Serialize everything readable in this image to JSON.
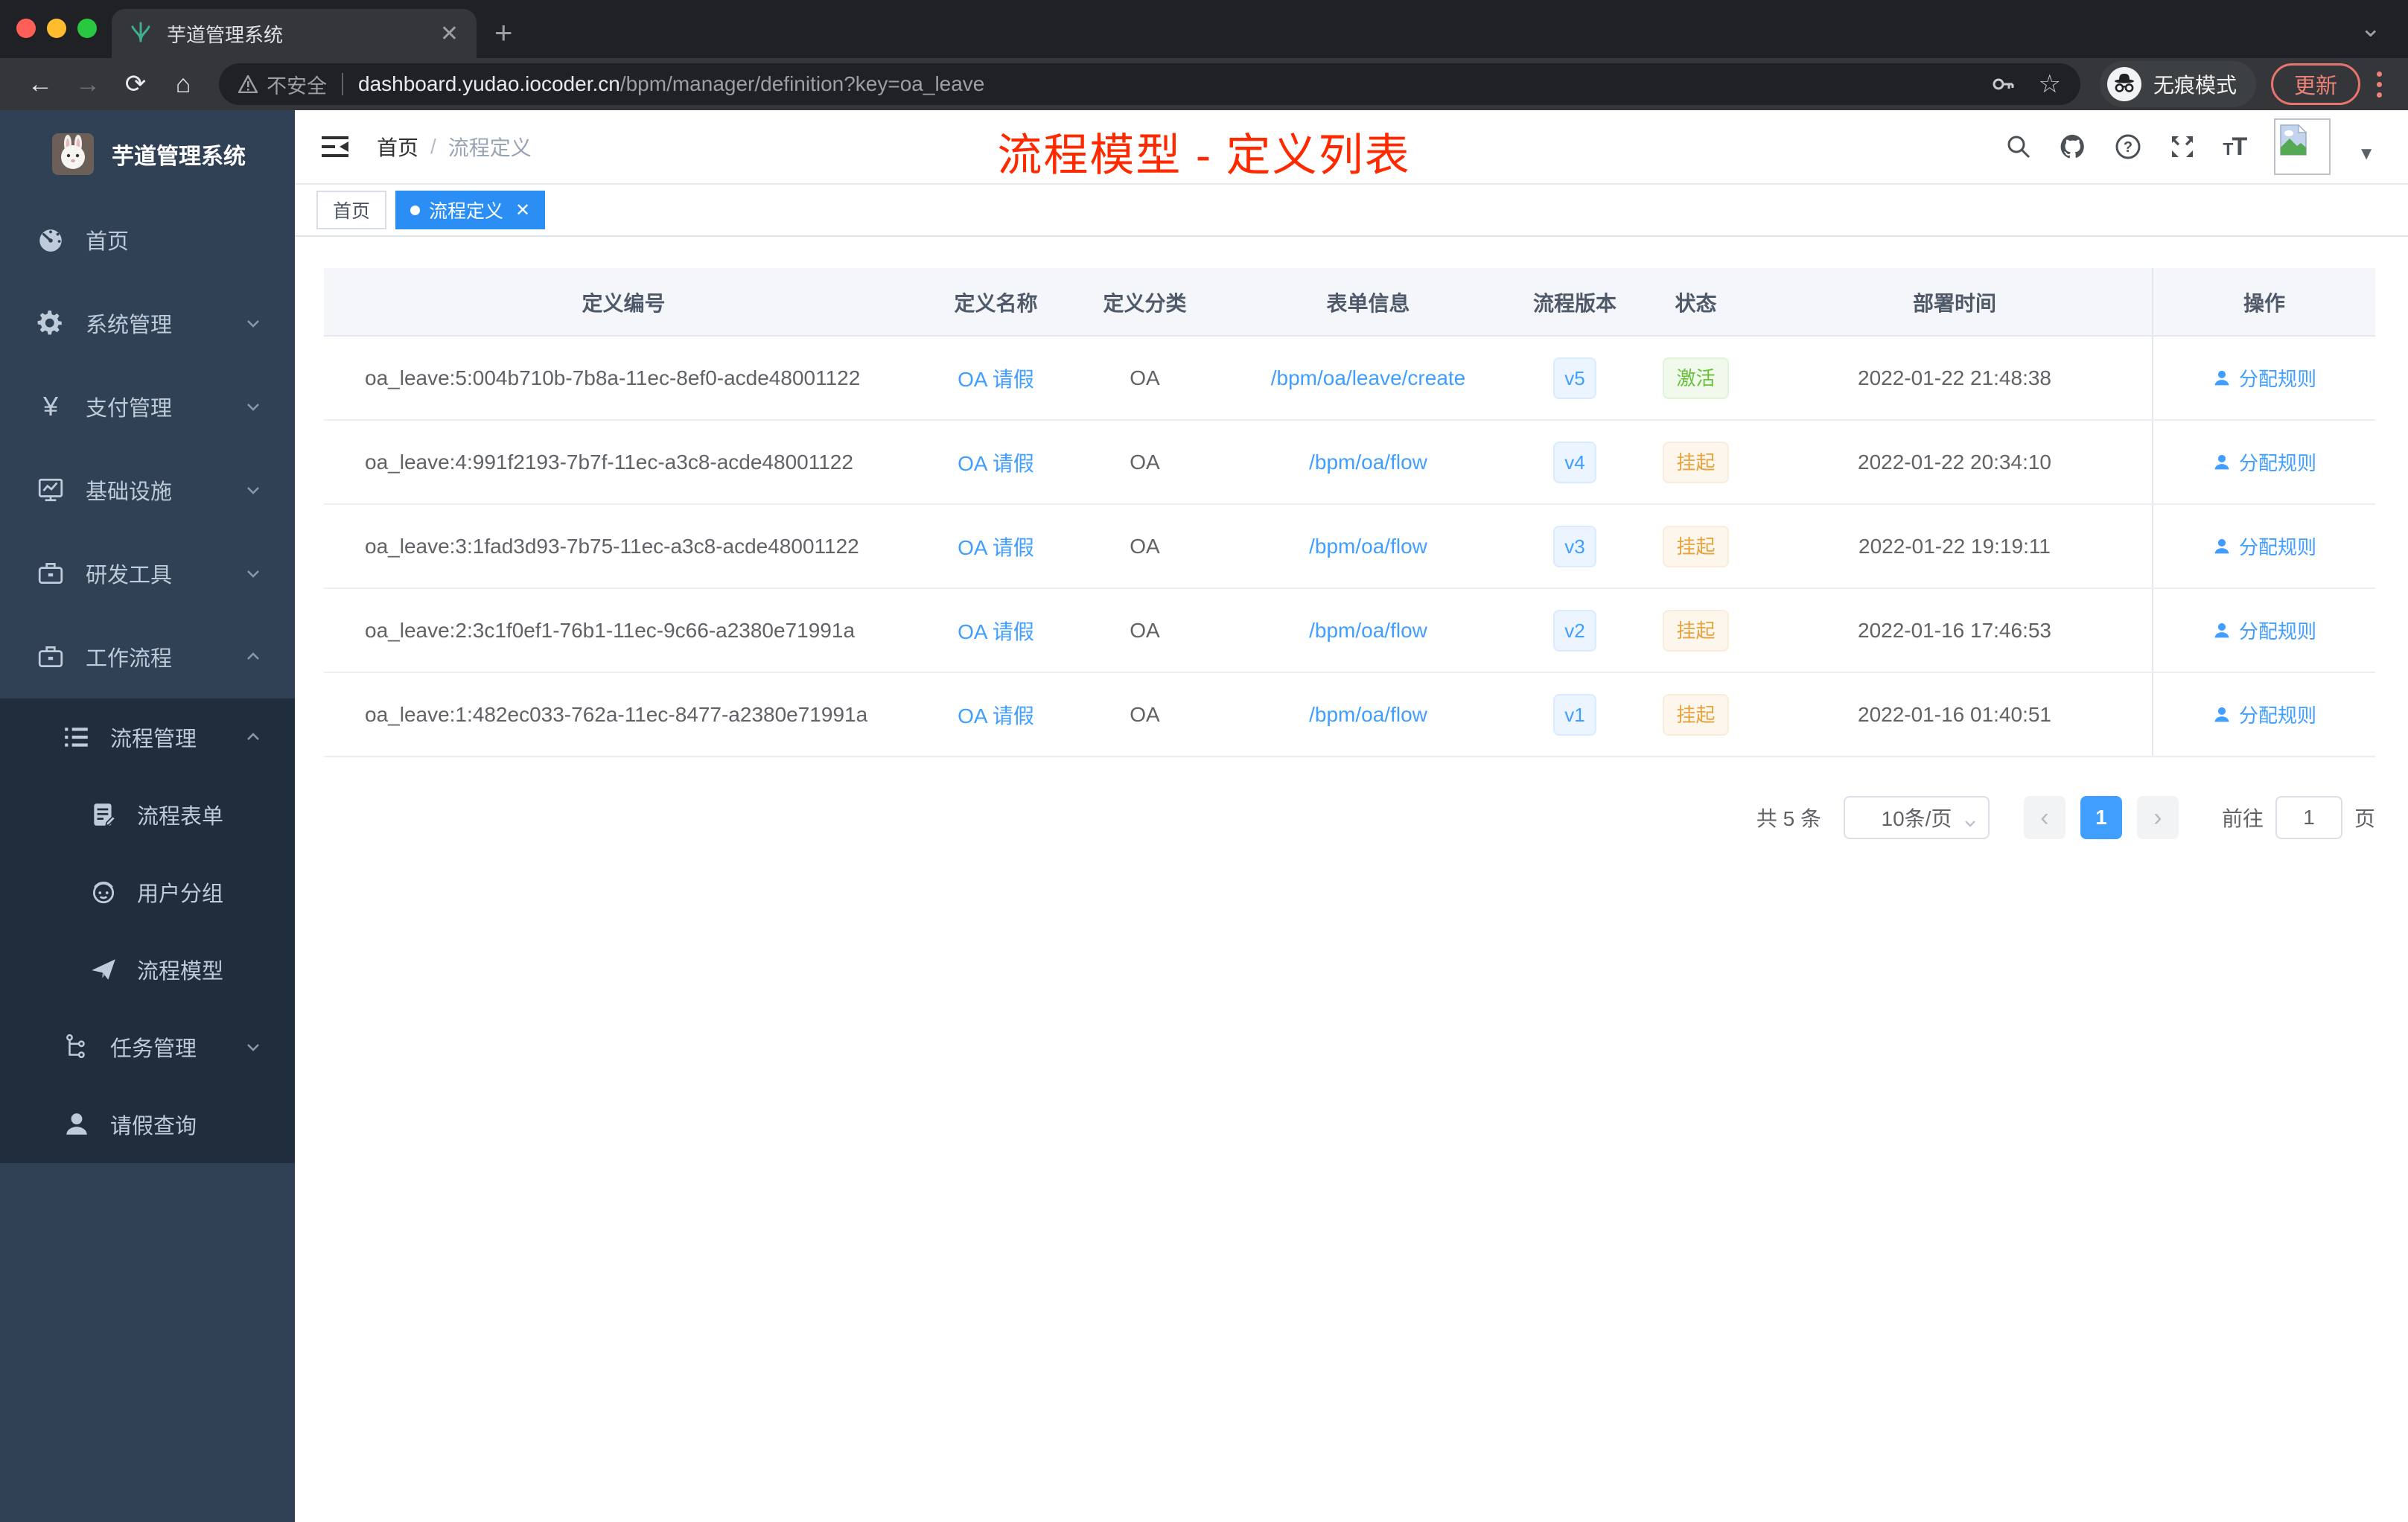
{
  "browser": {
    "tab_title": "芋道管理系统",
    "new_tab": "+",
    "security_label": "不安全",
    "url_domain": "dashboard.yudao.iocoder.cn",
    "url_path": "/bpm/manager/definition?key=oa_leave",
    "incognito_label": "无痕模式",
    "update_label": "更新"
  },
  "sidebar": {
    "logo_title": "芋道管理系统",
    "items": [
      {
        "label": "首页",
        "icon": "gauge-icon"
      },
      {
        "label": "系统管理",
        "icon": "gear-icon"
      },
      {
        "label": "支付管理",
        "icon": "yen-icon"
      },
      {
        "label": "基础设施",
        "icon": "monitor-icon"
      },
      {
        "label": "研发工具",
        "icon": "briefcase-icon"
      },
      {
        "label": "工作流程",
        "icon": "briefcase-icon"
      },
      {
        "label": "流程管理",
        "icon": "list-icon"
      },
      {
        "label": "流程表单",
        "icon": "form-icon"
      },
      {
        "label": "用户分组",
        "icon": "group-icon"
      },
      {
        "label": "流程模型",
        "icon": "paper-plane-icon"
      },
      {
        "label": "任务管理",
        "icon": "tree-icon"
      },
      {
        "label": "请假查询",
        "icon": "person-icon"
      }
    ]
  },
  "navbar": {
    "breadcrumb_home": "首页",
    "breadcrumb_separator": "/",
    "breadcrumb_current": "流程定义",
    "overlay_title": "流程模型 - 定义列表"
  },
  "tags": {
    "home": "首页",
    "active": "流程定义"
  },
  "table": {
    "columns": [
      "定义编号",
      "定义名称",
      "定义分类",
      "表单信息",
      "流程版本",
      "状态",
      "部署时间",
      "操作"
    ],
    "action_label": "分配规则",
    "rows": [
      {
        "id": "oa_leave:5:004b710b-7b8a-11ec-8ef0-acde48001122",
        "name": "OA 请假",
        "category": "OA",
        "form": "/bpm/oa/leave/create",
        "version": "v5",
        "status": "激活",
        "deploy_time": "2022-01-22 21:48:38"
      },
      {
        "id": "oa_leave:4:991f2193-7b7f-11ec-a3c8-acde48001122",
        "name": "OA 请假",
        "category": "OA",
        "form": "/bpm/oa/flow",
        "version": "v4",
        "status": "挂起",
        "deploy_time": "2022-01-22 20:34:10"
      },
      {
        "id": "oa_leave:3:1fad3d93-7b75-11ec-a3c8-acde48001122",
        "name": "OA 请假",
        "category": "OA",
        "form": "/bpm/oa/flow",
        "version": "v3",
        "status": "挂起",
        "deploy_time": "2022-01-22 19:19:11"
      },
      {
        "id": "oa_leave:2:3c1f0ef1-76b1-11ec-9c66-a2380e71991a",
        "name": "OA 请假",
        "category": "OA",
        "form": "/bpm/oa/flow",
        "version": "v2",
        "status": "挂起",
        "deploy_time": "2022-01-16 17:46:53"
      },
      {
        "id": "oa_leave:1:482ec033-762a-11ec-8477-a2380e71991a",
        "name": "OA 请假",
        "category": "OA",
        "form": "/bpm/oa/flow",
        "version": "v1",
        "status": "挂起",
        "deploy_time": "2022-01-16 01:40:51"
      }
    ]
  },
  "pagination": {
    "total_text": "共 5 条",
    "page_size": "10条/页",
    "current_page": "1",
    "goto_label": "前往",
    "page_unit": "页"
  },
  "colors": {
    "primary": "#409eff",
    "status_active": "#67c23a",
    "status_suspended": "#e6a23c",
    "overlay_red": "#ff2900",
    "sidebar_bg": "#304156",
    "submenu_bg": "#1f2d3d"
  }
}
